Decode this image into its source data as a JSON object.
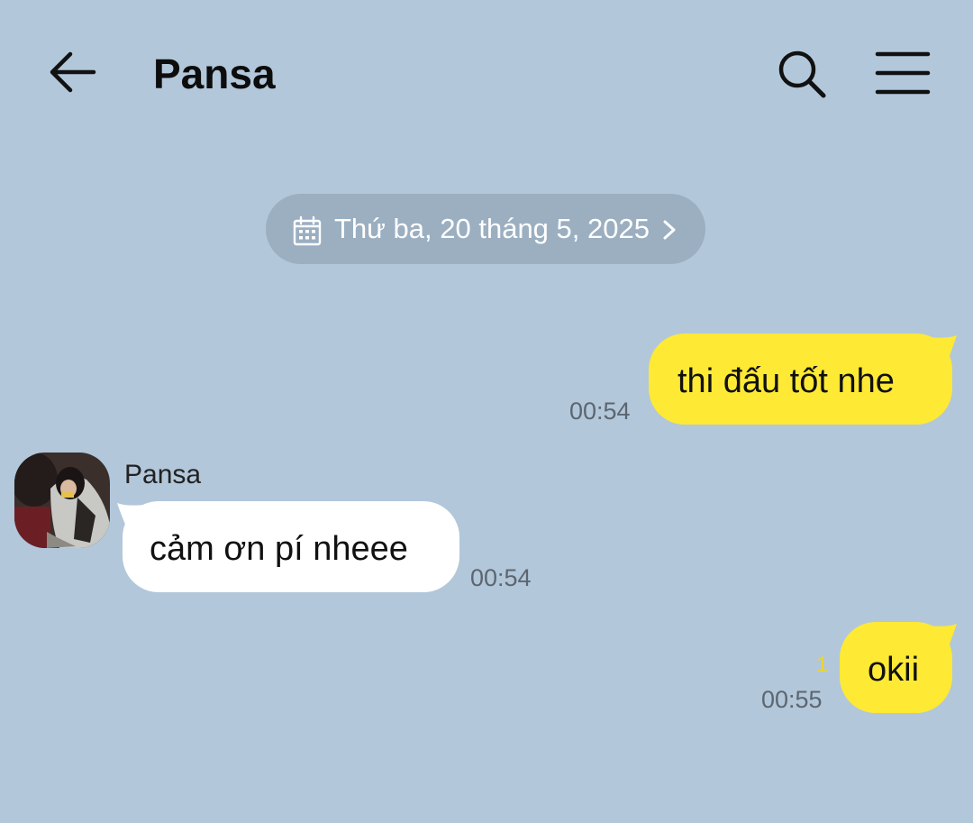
{
  "header": {
    "title": "Pansa",
    "back_icon": "arrow-left-icon",
    "search_icon": "search-icon",
    "menu_icon": "hamburger-menu-icon"
  },
  "date_divider": {
    "text": "Thứ ba, 20 tháng 5, 2025",
    "icon": "calendar-icon",
    "chevron_icon": "chevron-right-icon"
  },
  "messages": [
    {
      "direction": "outgoing",
      "text": "thi đấu tốt nhe",
      "time": "00:54"
    },
    {
      "direction": "incoming",
      "sender": "Pansa",
      "text": "cảm ơn pí nheee",
      "time": "00:54"
    },
    {
      "direction": "outgoing",
      "text": "okii",
      "time": "00:55",
      "unread_count": "1"
    }
  ],
  "colors": {
    "background": "#b2c7da",
    "outgoing_bubble": "#fee935",
    "incoming_bubble": "#ffffff",
    "date_pill": "#9bafc1",
    "time_text": "#5d6670",
    "unread": "#e9d633"
  }
}
